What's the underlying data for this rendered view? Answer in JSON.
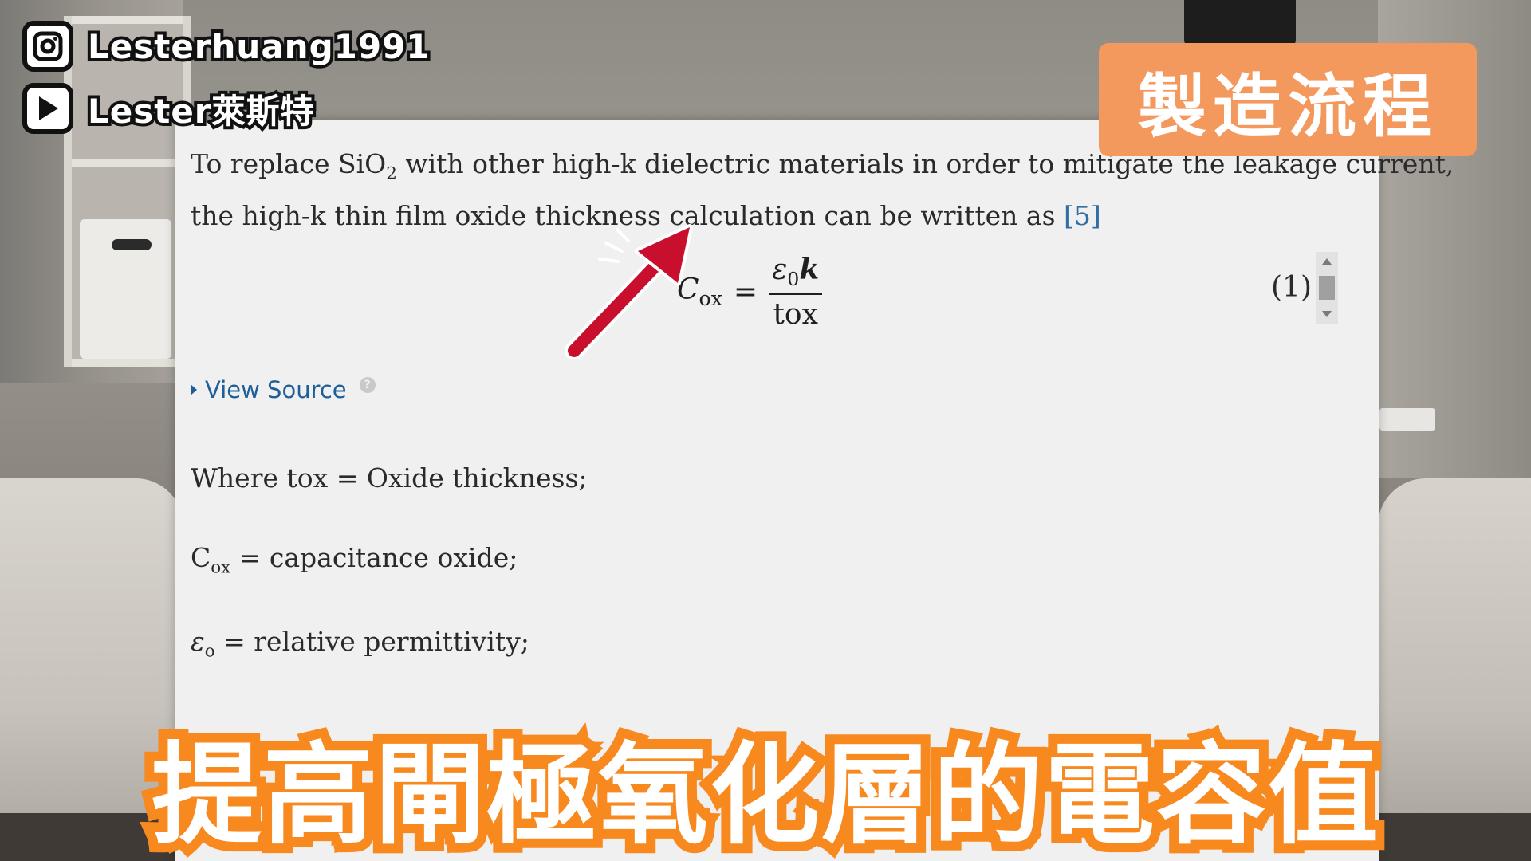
{
  "overlay": {
    "instagram_handle": "Lesterhuang1991",
    "youtube_channel": "Lester萊斯特",
    "tag": "製造流程",
    "subtitle": "提高閘極氧化層的電容值"
  },
  "article": {
    "line1_pre": "To replace SiO",
    "line1_sub": "2",
    "line1_post": " with other high-k dielectric materials in order to mitigate the leakage current,",
    "line2": "the high-k thin film oxide thickness calculation can be written as ",
    "ref": "[5]",
    "equation": {
      "lhs": "C",
      "lhs_sub": "ox",
      "equals": "=",
      "num": "ε",
      "num_sub": "0",
      "num_var": "k",
      "den": "tox",
      "number": "(1)"
    },
    "view_source": "View Source",
    "help_glyph": "?",
    "defs": {
      "d1": "Where tox = Oxide thickness;",
      "d2_main": "C",
      "d2_sub": "ox",
      "d2_rest": " = capacitance oxide;",
      "d3_main": "ε",
      "d3_sub": "o",
      "d3_rest": " = relative permittivity;"
    }
  },
  "colors": {
    "link": "#1f5f99",
    "tag_bg": "#f4995e",
    "subtitle_stroke": "#f7891f",
    "arrow": "#c8102e"
  }
}
